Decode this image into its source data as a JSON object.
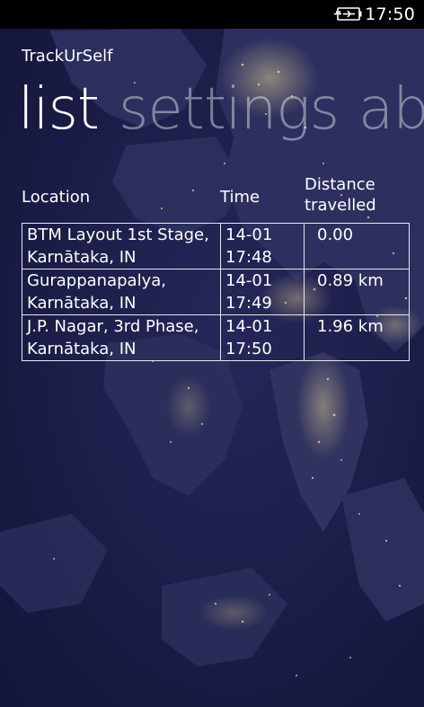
{
  "status_bar": {
    "battery_icon": "battery-charging-icon",
    "time": "17:50"
  },
  "app": {
    "title": "TrackUrSelf"
  },
  "pivot": {
    "items": [
      "list",
      "settings",
      "abo"
    ]
  },
  "table": {
    "headers": {
      "location": "Location",
      "time": "Time",
      "distance_line1": "Distance",
      "distance_line2": "travelled"
    },
    "rows": [
      {
        "location_line1": "BTM Layout 1st Stage,",
        "location_line2": "Karnātaka, IN",
        "date": "14-01",
        "time": "17:48",
        "distance": "0.00"
      },
      {
        "location_line1": "Gurappanapalya,",
        "location_line2": "Karnātaka, IN",
        "date": "14-01",
        "time": "17:49",
        "distance": "0.89 km"
      },
      {
        "location_line1": "J.P. Nagar, 3rd Phase,",
        "location_line2": "Karnātaka, IN",
        "date": "14-01",
        "time": "17:50",
        "distance": "1.96 km"
      }
    ]
  },
  "background": {
    "image": "night-earth-map",
    "sea_color": "#1b1c45",
    "land_color": "#2f3160",
    "light_color": "#f3d98a"
  }
}
